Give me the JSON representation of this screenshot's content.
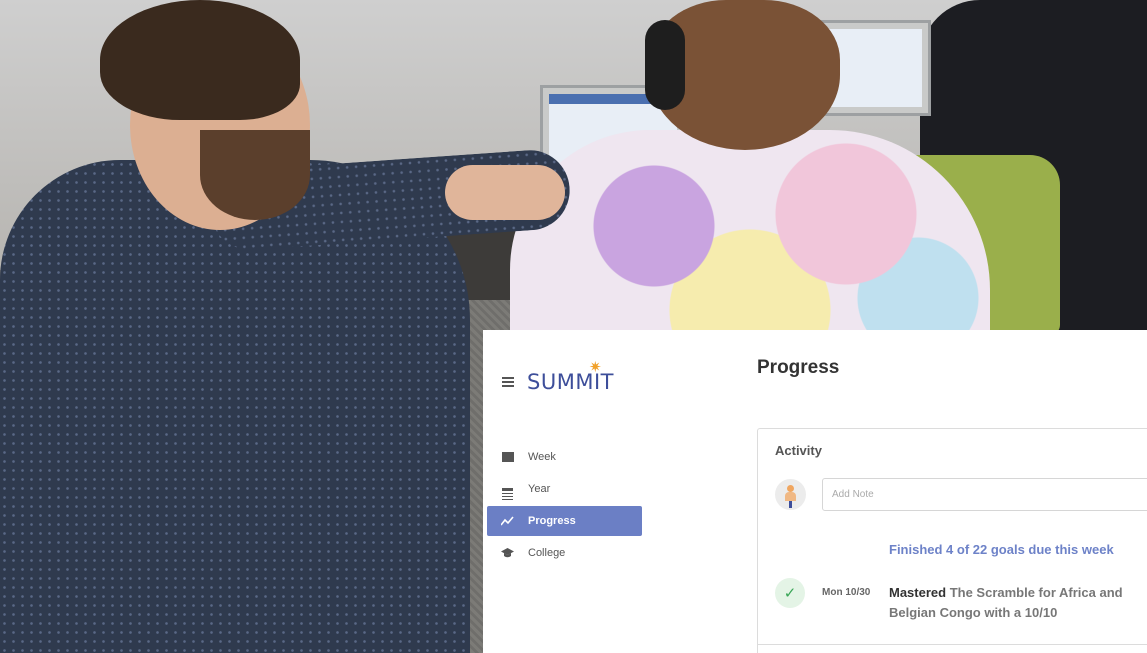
{
  "app": {
    "logo_text": "SUMMIT",
    "page_title": "Progress",
    "nav": [
      {
        "label": "Week",
        "icon": "calendar-week-icon"
      },
      {
        "label": "Year",
        "icon": "list-icon"
      },
      {
        "label": "Progress",
        "icon": "trend-line-icon",
        "active": true
      },
      {
        "label": "College",
        "icon": "graduation-cap-icon"
      }
    ],
    "activity": {
      "title": "Activity",
      "note_placeholder": "Add Note",
      "summary": "Finished 4 of 22 goals due this week",
      "items": [
        {
          "date": "Mon 10/30",
          "verb": "Mastered",
          "text": " The Scramble for Africa and Belgian Congo with a 10/10"
        }
      ]
    }
  },
  "colors": {
    "accent": "#6b7fc5",
    "logo": "#3d4e9a",
    "logo_sun": "#f1a12a",
    "success": "#3aa657"
  }
}
